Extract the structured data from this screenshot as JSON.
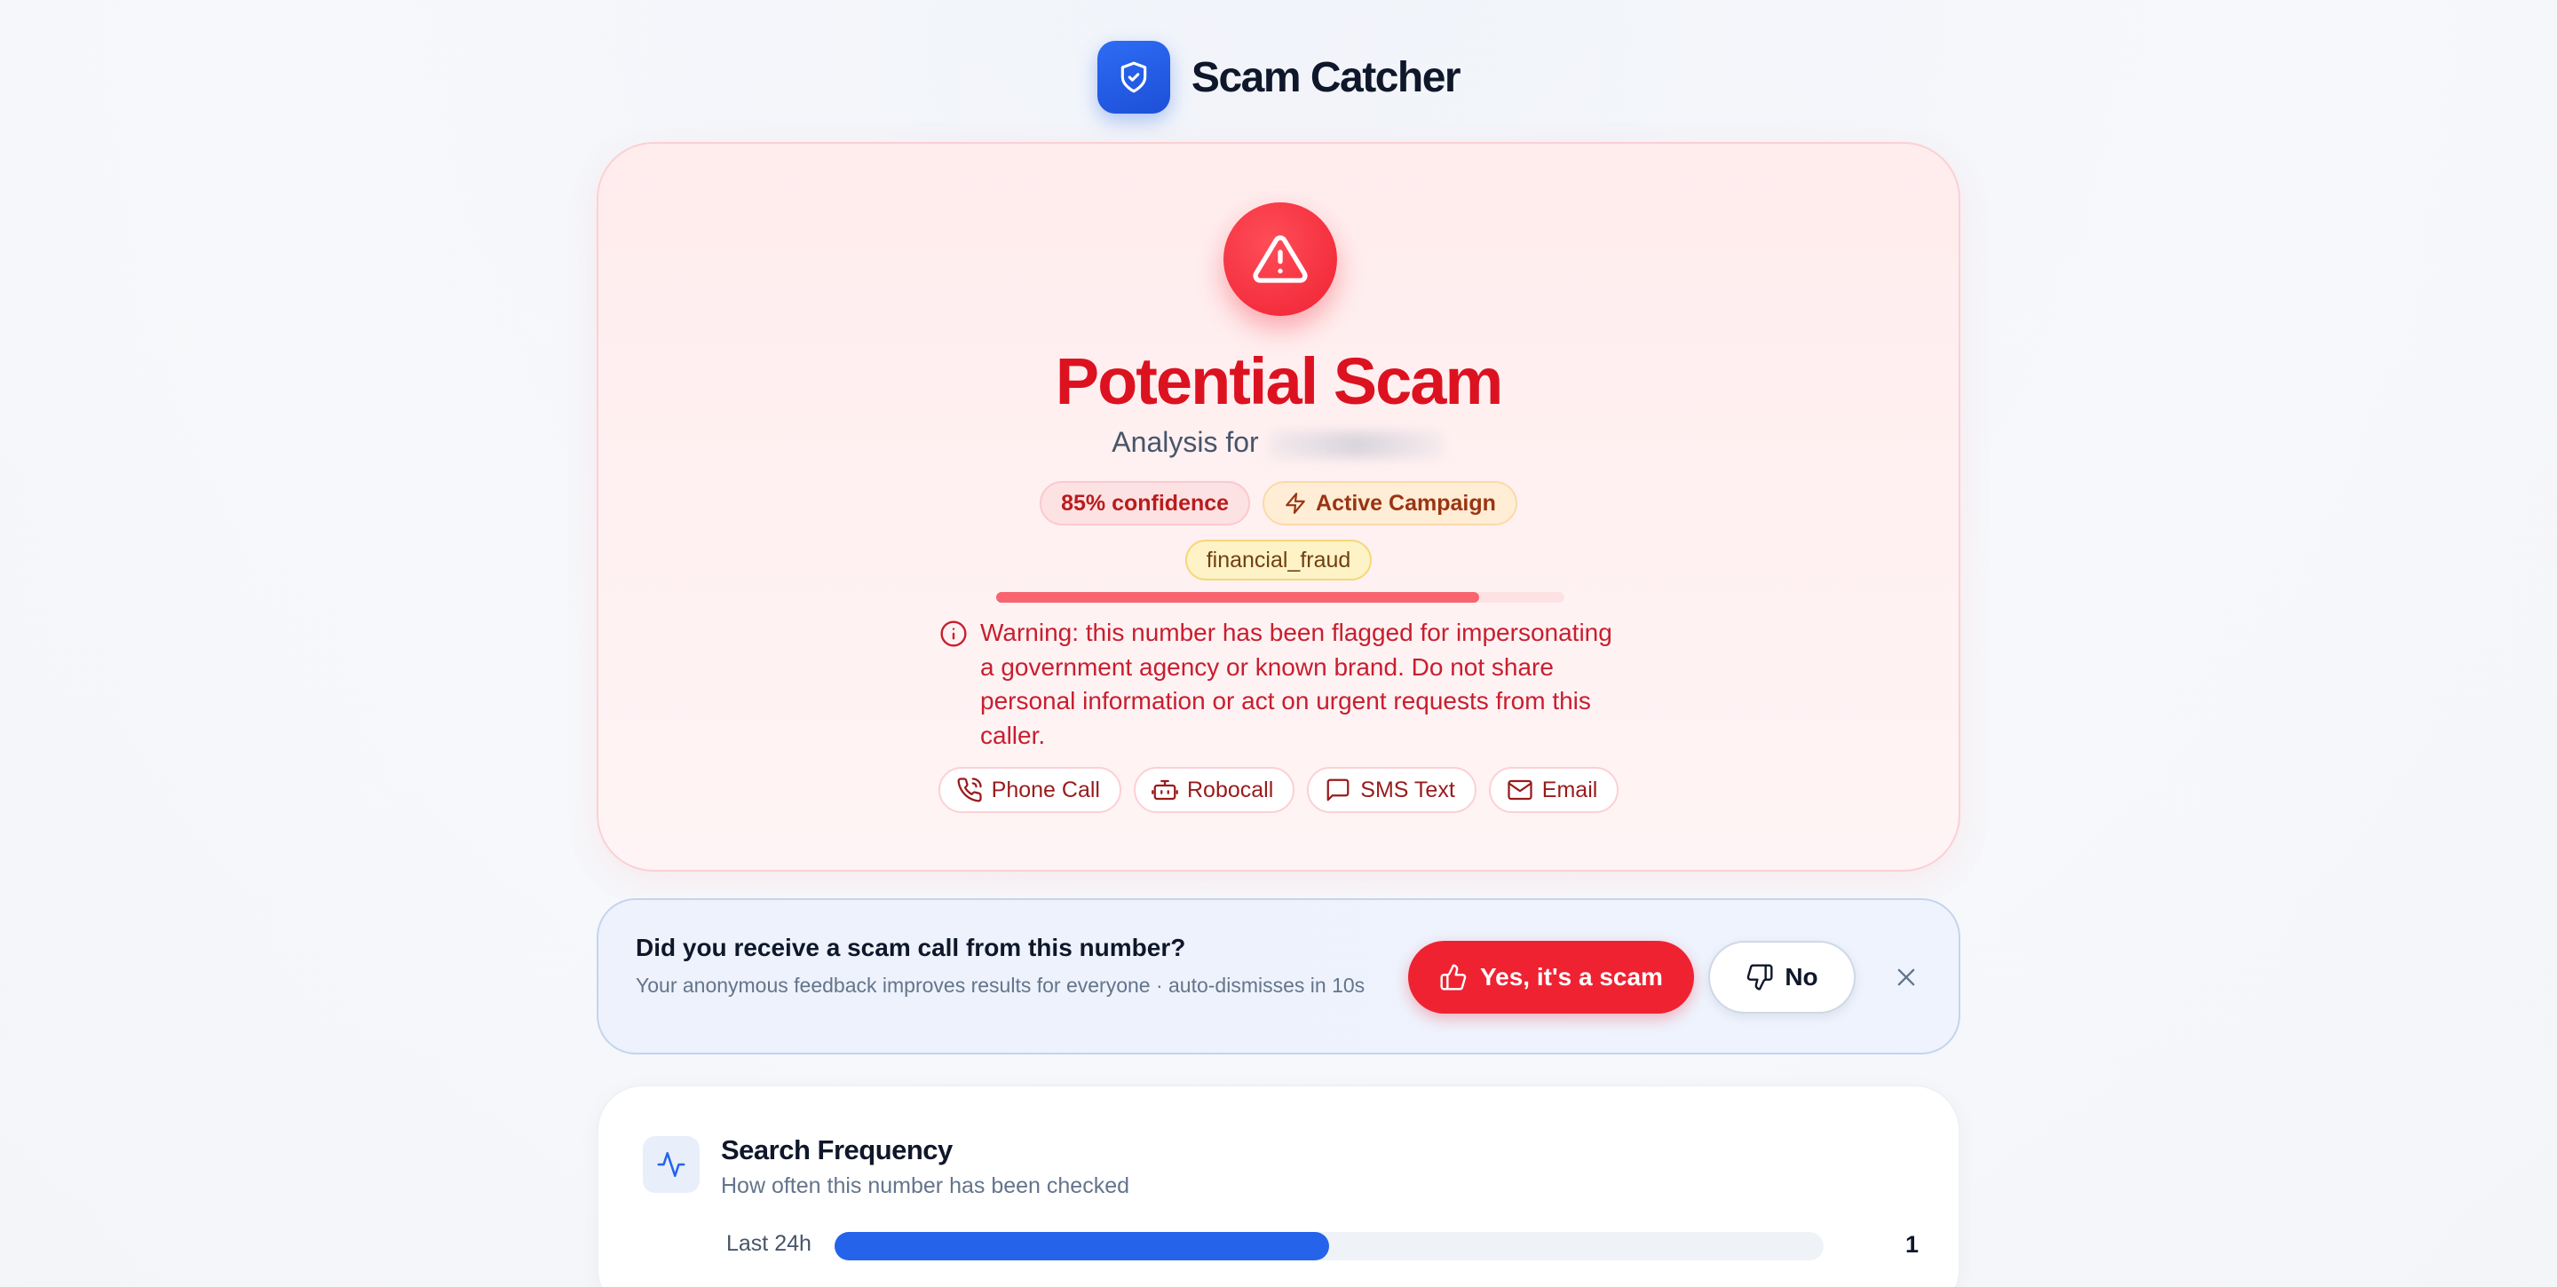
{
  "app": {
    "name": "Scam Catcher",
    "logo_icon": "shield-check-icon",
    "accent_color": "#2563eb"
  },
  "result": {
    "icon": "alert-triangle-icon",
    "verdict": "Potential Scam",
    "analysis_prefix": "Analysis for",
    "confidence_label": "85% confidence",
    "confidence_fraction": 0.85,
    "campaign_label": "Active Campaign",
    "category": "financial_fraud",
    "warning_text": "Warning: this number has been flagged for impersonating a government agency or known brand. Do not share personal information or act on urgent requests from this caller.",
    "danger_color": "#dc1220",
    "channels": [
      {
        "label": "Phone Call",
        "icon": "phone-call-icon"
      },
      {
        "label": "Robocall",
        "icon": "bot-icon"
      },
      {
        "label": "SMS Text",
        "icon": "message-square-icon"
      },
      {
        "label": "Email",
        "icon": "mail-icon"
      }
    ]
  },
  "feedback": {
    "question": "Did you receive a scam call from this number?",
    "subtitle": "Your anonymous feedback improves results for everyone · auto-dismisses in 10s",
    "yes_label": "Yes, it's a scam",
    "no_label": "No"
  },
  "frequency": {
    "title": "Search Frequency",
    "subtitle": "How often this number has been checked",
    "rows": [
      {
        "label": "Last 24h",
        "count": "1",
        "fraction": 0.5
      }
    ]
  }
}
